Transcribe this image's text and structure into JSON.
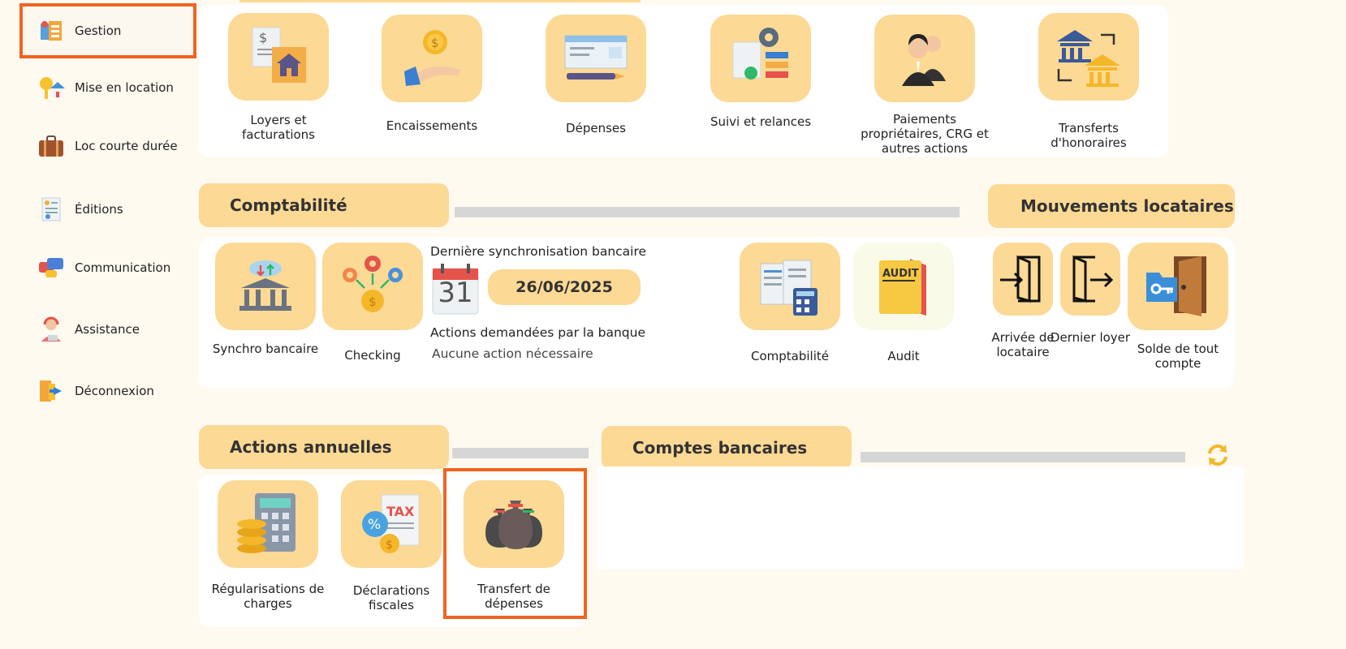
{
  "sidebar": {
    "items": [
      {
        "label": "Gestion",
        "icon": "management-icon"
      },
      {
        "label": "Mise en location",
        "icon": "house-key-icon"
      },
      {
        "label": "Loc courte durée",
        "icon": "suitcase-icon"
      },
      {
        "label": "Éditions",
        "icon": "document-report-icon"
      },
      {
        "label": "Communication",
        "icon": "chat-bubbles-icon"
      },
      {
        "label": "Assistance",
        "icon": "support-agent-icon"
      },
      {
        "label": "Déconnexion",
        "icon": "logout-icon"
      }
    ]
  },
  "gestion": {
    "tiles": [
      {
        "label": "Loyers et facturations",
        "icon": "rent-invoice-icon"
      },
      {
        "label": "Encaissements",
        "icon": "coin-hand-icon"
      },
      {
        "label": "Dépenses",
        "icon": "cheque-icon"
      },
      {
        "label": "Suivi et relances",
        "icon": "follow-up-gear-icon"
      },
      {
        "label": "Paiements propriétaires, CRG et autres actions",
        "icon": "owners-icon"
      },
      {
        "label": "Transferts d'honoraires",
        "icon": "bank-transfer-icon"
      }
    ]
  },
  "comptabilite": {
    "title": "Comptabilité",
    "tiles": [
      {
        "label": "Synchro bancaire",
        "icon": "bank-sync-icon"
      },
      {
        "label": "Checking",
        "icon": "checking-network-icon"
      },
      {
        "label": "Comptabilité",
        "icon": "ledger-calculator-icon"
      },
      {
        "label": "Audit",
        "icon": "audit-folder-icon"
      }
    ],
    "sync_label": "Dernière synchronisation bancaire",
    "calendar_day": "31",
    "sync_date": "26/06/2025",
    "actions_label": "Actions demandées par la banque",
    "actions_value": "Aucune action nécessaire"
  },
  "mouvements": {
    "title": "Mouvements locataires",
    "tiles": [
      {
        "label": "Arrivée de locataire",
        "icon": "door-enter-icon"
      },
      {
        "label": "Dernier loyer",
        "icon": "door-exit-icon"
      },
      {
        "label": "Solde de tout compte",
        "icon": "key-door-icon"
      }
    ]
  },
  "annuelles": {
    "title": "Actions annuelles",
    "tiles": [
      {
        "label": "Régularisations de charges",
        "icon": "calculator-coins-icon"
      },
      {
        "label": "Déclarations fiscales",
        "icon": "tax-icon"
      },
      {
        "label": "Transfert de dépenses",
        "icon": "money-bags-icon"
      }
    ]
  },
  "comptes": {
    "title": "Comptes bancaires",
    "refresh_icon": "refresh-icon"
  },
  "colors": {
    "accent_orange": "#f26322",
    "tile_bg": "#fcd995",
    "page_bg": "#fefaf0"
  }
}
